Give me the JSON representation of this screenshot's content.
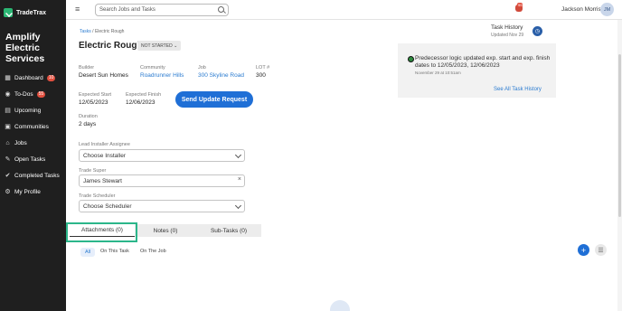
{
  "brand": {
    "name": "TradeTrax"
  },
  "sidebar": {
    "company": [
      "Amplify",
      "Electric",
      "Services"
    ],
    "items": [
      {
        "label": "Dashboard",
        "badge": "10",
        "icon": "calendar-icon"
      },
      {
        "label": "To-Dos",
        "badge": "55",
        "icon": "check-circle-icon"
      },
      {
        "label": "Upcoming",
        "badge": "",
        "icon": "list-icon"
      },
      {
        "label": "Communities",
        "badge": "",
        "icon": "message-icon"
      },
      {
        "label": "Jobs",
        "badge": "",
        "icon": "home-icon"
      },
      {
        "label": "Open Tasks",
        "badge": "",
        "icon": "wrench-icon"
      },
      {
        "label": "Completed Tasks",
        "badge": "",
        "icon": "check-icon"
      },
      {
        "label": "My Profile",
        "badge": "",
        "icon": "gear-icon"
      }
    ]
  },
  "topbar": {
    "search_placeholder": "Search Jobs and Tasks",
    "notif_count": "99",
    "user_name": "Jackson Morris",
    "avatar_initials": "JM"
  },
  "breadcrumb": {
    "parent": "Tasks",
    "current": "Electric Rough"
  },
  "task": {
    "title": "Electric Rough",
    "status": "NOT STARTED",
    "builder_label": "Builder",
    "builder": "Desert Sun Homes",
    "community_label": "Community",
    "community": "Roadrunner Hills",
    "job_label": "Job",
    "job": "300 Skyline Road",
    "lot_label": "LOT #",
    "lot": "300",
    "expected_start_label": "Expected Start",
    "expected_start": "12/05/2023",
    "expected_finish_label": "Expected Finish",
    "expected_finish": "12/06/2023",
    "send_update_label": "Send Update Request",
    "duration_label": "Duration",
    "duration": "2 days",
    "lead_installer_label": "Lead Installer Assignee",
    "lead_installer": "Choose Installer",
    "trade_super_label": "Trade Super",
    "trade_super": "James Stewart",
    "trade_scheduler_label": "Trade Scheduler",
    "trade_scheduler": "Choose Scheduler"
  },
  "tabs": [
    {
      "label": "Attachments (0)"
    },
    {
      "label": "Notes (0)"
    },
    {
      "label": "Sub-Tasks (0)"
    }
  ],
  "filters": {
    "all": "All",
    "on_task": "On This Task",
    "on_job": "On The Job"
  },
  "history": {
    "title": "Task History",
    "updated": "Updated Nov 29",
    "entry": "Predecessor logic updated exp. start and exp. finish dates to 12/05/2023, 12/06/2023",
    "time": "November 29 at 10:51am",
    "see_all": "See All Task History"
  },
  "colors": {
    "primary": "#1f6fd6",
    "sidebar": "#1f1f1f",
    "highlight": "#2bb68a"
  }
}
